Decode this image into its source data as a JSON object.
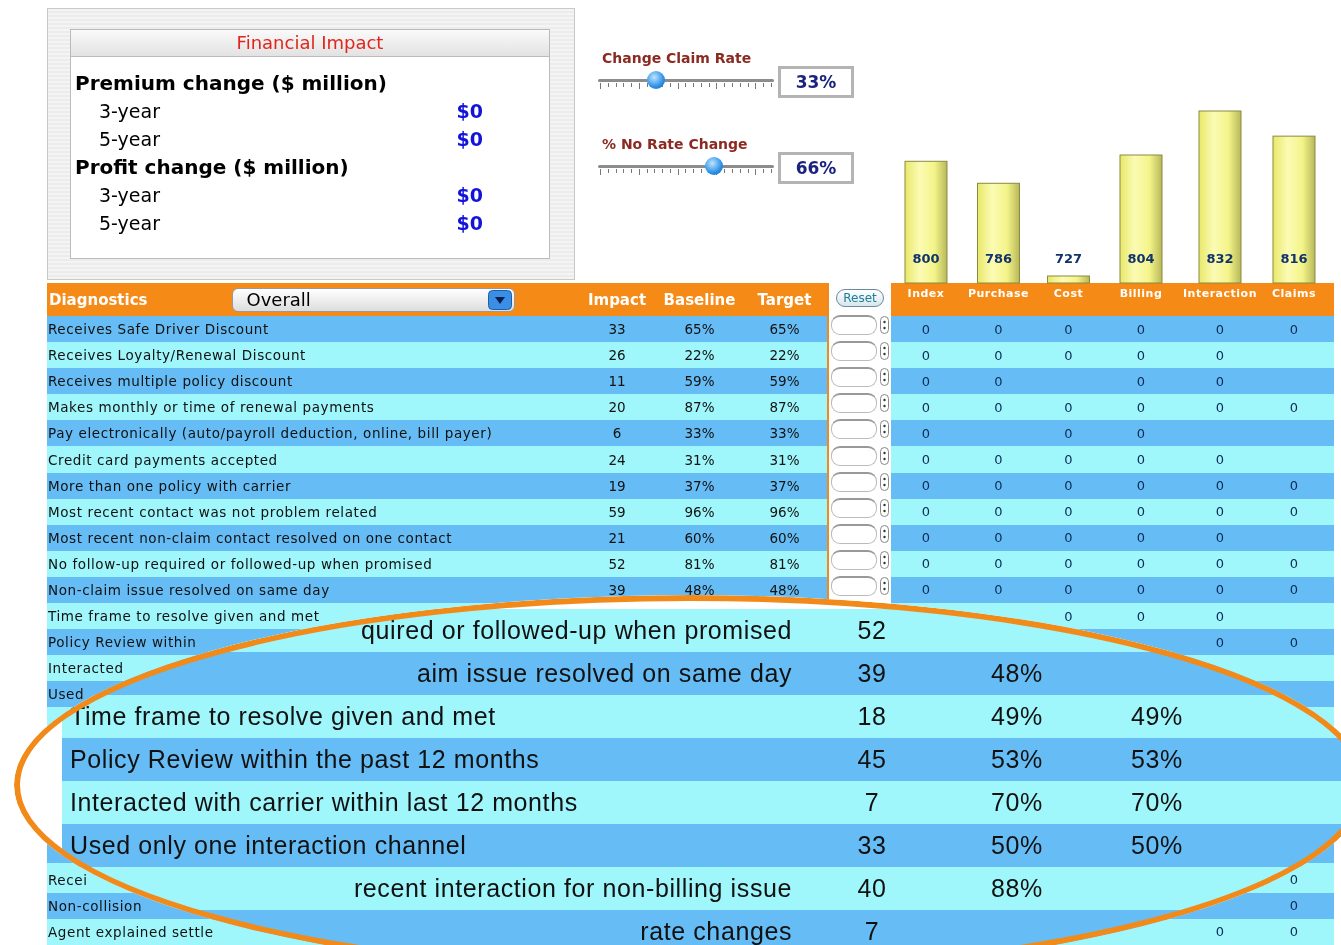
{
  "financial_impact": {
    "title": "Financial Impact",
    "sections": [
      {
        "title": "Premium change ($ million)",
        "rows": [
          {
            "label": "3-year",
            "value": "$0"
          },
          {
            "label": "5-year",
            "value": "$0"
          }
        ]
      },
      {
        "title": "Profit change ($ million)",
        "rows": [
          {
            "label": "3-year",
            "value": "$0"
          },
          {
            "label": "5-year",
            "value": "$0"
          }
        ]
      }
    ]
  },
  "sliders": [
    {
      "label": "Change Claim Rate",
      "level": 0.33,
      "reading": "33%"
    },
    {
      "label": "% No Rate Change",
      "level": 0.66,
      "reading": "66%"
    }
  ],
  "score_bars": [
    {
      "category": "Index",
      "value": "800"
    },
    {
      "category": "Purchase",
      "value": "786"
    },
    {
      "category": "Cost",
      "value": "727"
    },
    {
      "category": "Billing",
      "value": "804"
    },
    {
      "category": "Interaction",
      "value": "832"
    },
    {
      "category": "Claims",
      "value": "816"
    }
  ],
  "diagnostics": {
    "title": "Diagnostics",
    "dropdown": "Overall",
    "columns": [
      "Impact",
      "Baseline",
      "Target"
    ],
    "reset": "Reset",
    "rows": [
      {
        "label": "Receives Safe Driver Discount",
        "impact": "33",
        "baseline": "65%",
        "target": "65%",
        "scores": {
          "index": "0",
          "purchase": "0",
          "cost": "0",
          "billing": "0",
          "interaction": "0",
          "claims": "0"
        }
      },
      {
        "label": "Receives Loyalty/Renewal Discount",
        "impact": "26",
        "baseline": "22%",
        "target": "22%",
        "scores": {
          "index": "0",
          "purchase": "0",
          "cost": "0",
          "billing": "0",
          "interaction": "0"
        }
      },
      {
        "label": "Receives multiple policy discount",
        "impact": "11",
        "baseline": "59%",
        "target": "59%",
        "scores": {
          "index": "0",
          "purchase": "0",
          "billing": "0",
          "interaction": "0"
        }
      },
      {
        "label": "Makes monthly or time of renewal payments",
        "impact": "20",
        "baseline": "87%",
        "target": "87%",
        "scores": {
          "index": "0",
          "purchase": "0",
          "cost": "0",
          "billing": "0",
          "interaction": "0",
          "claims": "0"
        }
      },
      {
        "label": "Pay electronically (auto/payroll deduction, online, bill payer)",
        "impact": "6",
        "baseline": "33%",
        "target": "33%",
        "scores": {
          "index": "0",
          "cost": "0",
          "billing": "0"
        }
      },
      {
        "label": "Credit card payments accepted",
        "impact": "24",
        "baseline": "31%",
        "target": "31%",
        "scores": {
          "index": "0",
          "purchase": "0",
          "cost": "0",
          "billing": "0",
          "interaction": "0"
        }
      },
      {
        "label": "More than one policy with carrier",
        "impact": "19",
        "baseline": "37%",
        "target": "37%",
        "scores": {
          "index": "0",
          "purchase": "0",
          "cost": "0",
          "billing": "0",
          "interaction": "0",
          "claims": "0"
        }
      },
      {
        "label": "Most recent contact was not problem related",
        "impact": "59",
        "baseline": "96%",
        "target": "96%",
        "scores": {
          "index": "0",
          "purchase": "0",
          "cost": "0",
          "billing": "0",
          "interaction": "0",
          "claims": "0"
        }
      },
      {
        "label": "Most recent non-claim contact resolved on one contact",
        "impact": "21",
        "baseline": "60%",
        "target": "60%",
        "scores": {
          "index": "0",
          "purchase": "0",
          "cost": "0",
          "billing": "0",
          "interaction": "0"
        }
      },
      {
        "label": "No follow-up required or followed-up when promised",
        "impact": "52",
        "baseline": "81%",
        "target": "81%",
        "scores": {
          "index": "0",
          "purchase": "0",
          "cost": "0",
          "billing": "0",
          "interaction": "0",
          "claims": "0"
        }
      },
      {
        "label": "Non-claim issue resolved on same day",
        "impact": "39",
        "baseline": "48%",
        "target": "48%",
        "scores": {
          "index": "0",
          "purchase": "0",
          "cost": "0",
          "billing": "0",
          "interaction": "0",
          "claims": "0"
        }
      }
    ],
    "lower_rows": [
      {
        "label": "Time frame to resolve given and met",
        "scores": {
          "cost": "0",
          "billing": "0",
          "interaction": "0"
        }
      },
      {
        "label": "Policy Review within",
        "scores": {
          "interaction": "0",
          "claims": "0"
        }
      },
      {
        "label": "Interacted",
        "scores": {}
      },
      {
        "label": "Used",
        "scores": {}
      }
    ],
    "bottom_rows": [
      {
        "label": "Recei",
        "scores": {
          "claims": "0"
        }
      },
      {
        "label": "Non-collision",
        "scores": {
          "claims": "0"
        }
      },
      {
        "label": "Agent explained settle",
        "scores": {
          "interaction": "0",
          "claims": "0"
        }
      }
    ]
  },
  "magnifier": {
    "rows": [
      {
        "kind": "cut",
        "label": "quired or followed-up when promised",
        "impact": "52"
      },
      {
        "kind": "cut",
        "label": "aim issue resolved on same day",
        "impact": "39",
        "baseline": "48%"
      },
      {
        "kind": "full",
        "label": "Time frame to resolve given and met",
        "impact": "18",
        "baseline": "49%",
        "target": "49%"
      },
      {
        "kind": "full",
        "label": "Policy Review within the past 12 months",
        "impact": "45",
        "baseline": "53%",
        "target": "53%"
      },
      {
        "kind": "full",
        "label": "Interacted with carrier within last 12 months",
        "impact": "7",
        "baseline": "70%",
        "target": "70%"
      },
      {
        "kind": "full",
        "label": "Used only one interaction channel",
        "impact": "33",
        "baseline": "50%",
        "target": "50%"
      },
      {
        "kind": "cut",
        "label": "recent interaction for non-billing issue",
        "impact": "40",
        "baseline": "88%"
      },
      {
        "kind": "cut",
        "label": "rate changes",
        "impact": "7"
      }
    ]
  }
}
